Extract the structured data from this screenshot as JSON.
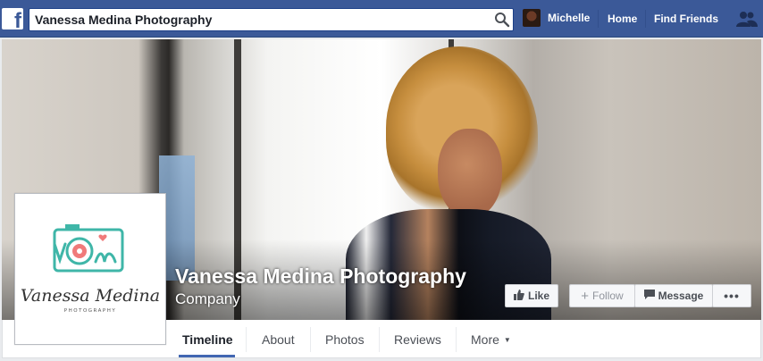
{
  "topbar": {
    "logo": "f",
    "search_value": "Vanessa Medina Photography",
    "user_name": "Michelle",
    "home_label": "Home",
    "find_friends_label": "Find Friends"
  },
  "cover": {
    "page_name": "Vanessa Medina Photography",
    "category": "Company"
  },
  "actions": {
    "like_label": "Like",
    "follow_label": "Follow",
    "message_label": "Message",
    "more_label": "•••"
  },
  "profile": {
    "logo_name": "Vanessa Medina",
    "logo_sub": "PHOTOGRAPHY",
    "logo_mark": "VM"
  },
  "tabs": {
    "timeline": "Timeline",
    "about": "About",
    "photos": "Photos",
    "reviews": "Reviews",
    "more": "More",
    "more_caret": "▼"
  },
  "colors": {
    "brand_blue": "#3b5998",
    "accent_blue": "#4267b2",
    "logo_teal": "#3fb6a8",
    "logo_pink": "#f07a7a"
  }
}
